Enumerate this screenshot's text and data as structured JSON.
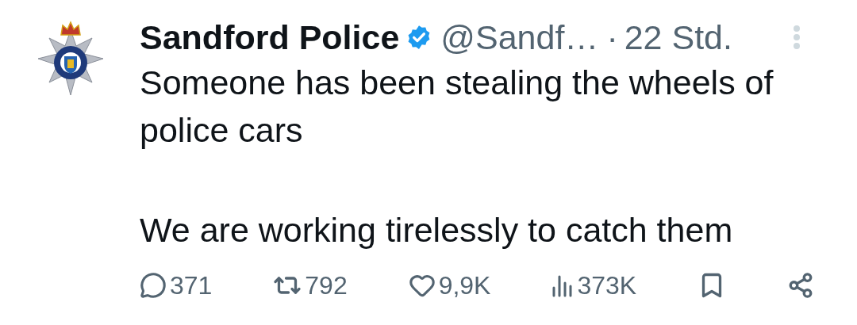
{
  "author": {
    "name": "Sandford Police",
    "verified": true,
    "handle": "@Sandf…",
    "separator": "·",
    "time": "22 Std."
  },
  "body": {
    "paragraphs": [
      "Someone has been stealing the wheels of police cars",
      "We are working tirelessly to catch them"
    ]
  },
  "actions": [
    {
      "kind": "reply",
      "count": "371"
    },
    {
      "kind": "repost",
      "count": "792"
    },
    {
      "kind": "like",
      "count": "9,9K"
    },
    {
      "kind": "views",
      "count": "373K"
    },
    {
      "kind": "bookmark"
    },
    {
      "kind": "share"
    }
  ]
}
